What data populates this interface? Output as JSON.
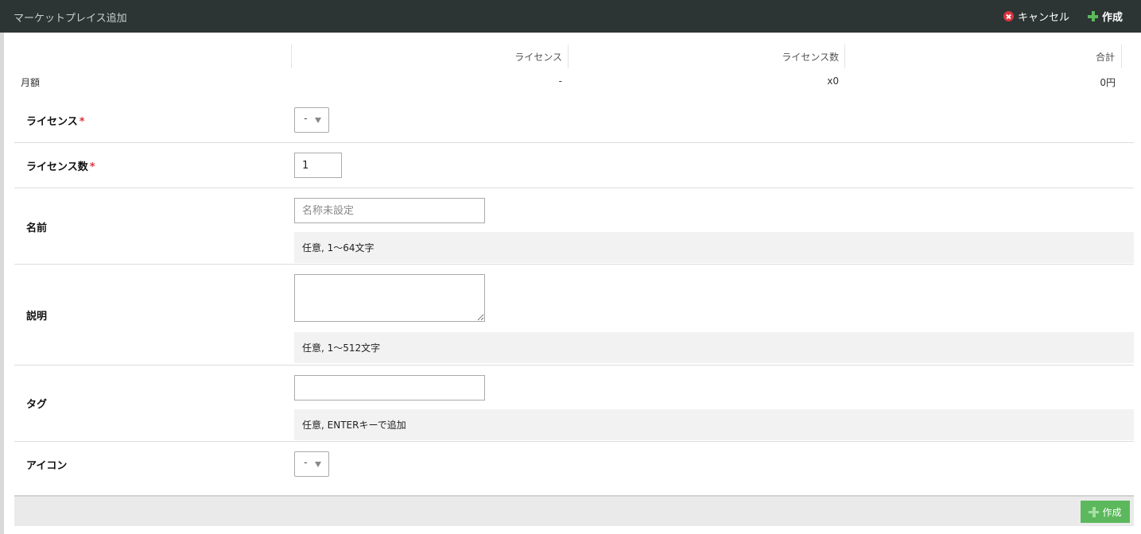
{
  "header": {
    "title": "マーケットプレイス追加",
    "cancel_label": "キャンセル",
    "create_label": "作成"
  },
  "summary": {
    "columns": [
      "ライセンス",
      "ライセンス数",
      "合計"
    ],
    "row_label": "月額",
    "values": [
      "-",
      "x0",
      "0円"
    ]
  },
  "form": {
    "license": {
      "label": "ライセンス",
      "required_mark": "*",
      "value": "-"
    },
    "license_count": {
      "label": "ライセンス数",
      "required_mark": "*",
      "value": "1"
    },
    "name": {
      "label": "名前",
      "placeholder": "名称未設定",
      "value": "",
      "hint": "任意, 1～64文字"
    },
    "description": {
      "label": "説明",
      "value": "",
      "hint": "任意, 1～512文字"
    },
    "tag": {
      "label": "タグ",
      "value": "",
      "hint": "任意, ENTERキーで追加"
    },
    "icon": {
      "label": "アイコン",
      "value": "-"
    }
  },
  "footer": {
    "create_label": "作成"
  },
  "colors": {
    "header_bg": "#2c3533",
    "accent_green": "#5cb85c",
    "cancel_red": "#d9343f"
  },
  "icons": {
    "cancel": "close-circle-icon",
    "create": "plus-icon"
  }
}
